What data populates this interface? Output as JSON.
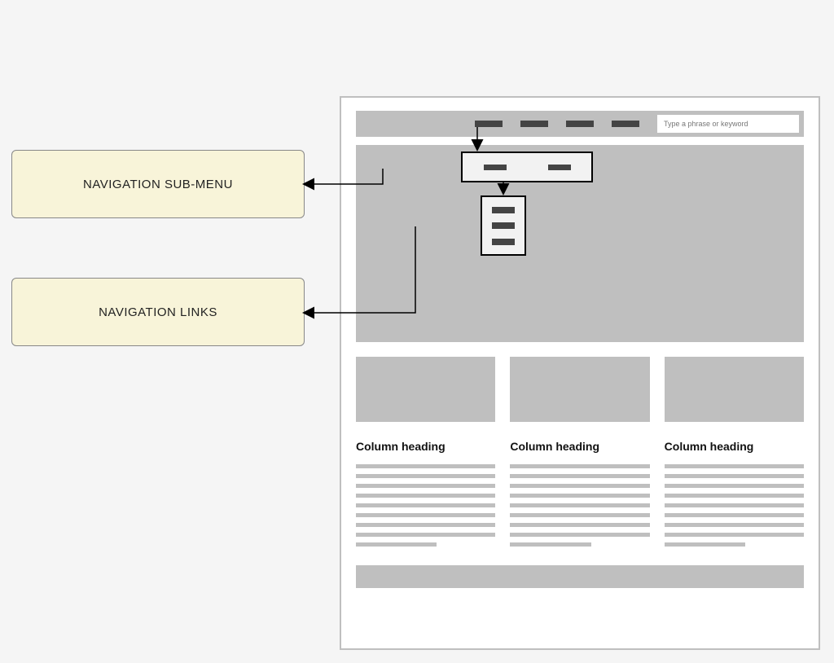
{
  "labels": {
    "submenu": "NAVIGATION SUB-MENU",
    "links": "NAVIGATION LINKS"
  },
  "search": {
    "placeholder": "Type a phrase or keyword"
  },
  "columns": [
    {
      "heading": "Column heading"
    },
    {
      "heading": "Column heading"
    },
    {
      "heading": "Column heading"
    }
  ]
}
